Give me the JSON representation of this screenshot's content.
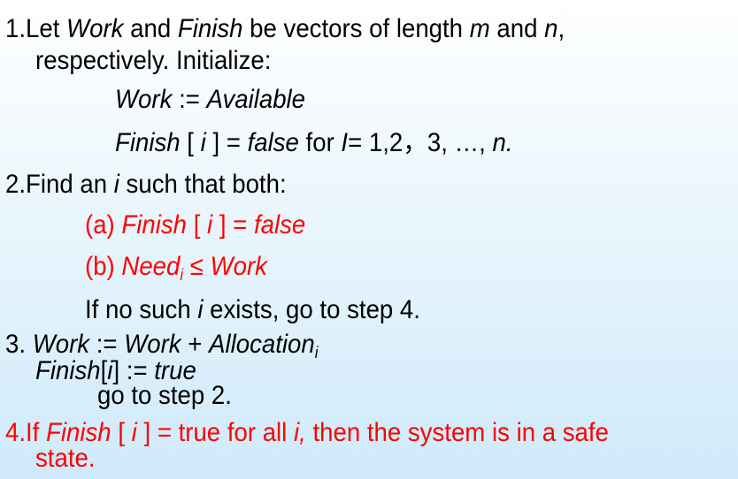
{
  "step1": {
    "line1": {
      "p1": "1.Let ",
      "i1": "Work",
      "p2": " and ",
      "i2": "Finish",
      "p3": " be vectors of length ",
      "i3": "m",
      "p4": " and ",
      "i4": "n",
      "p5": ","
    },
    "line2": "respectively.  Initialize:",
    "work_init": {
      "i1": "Work",
      "p1": " := ",
      "i2": "Available"
    },
    "finish_init": {
      "i1": "Finish",
      "p1": " [ ",
      "i2": "i",
      "p2": " ] = ",
      "i3": "false",
      "p3": " for ",
      "i4": "I",
      "p4": "= 1,2，3, …, ",
      "i5": "n."
    }
  },
  "step2": {
    "title": {
      "p1": "2.Find an ",
      "i1": "i",
      "p2": " such that both:"
    },
    "cond_a": {
      "p1": "(a) ",
      "i1": "Finish",
      "p2": " [ ",
      "i2": "i",
      "p3": " ] = ",
      "i3": "false"
    },
    "cond_b": {
      "p1": "(b) ",
      "i1": "Need",
      "sub": "i",
      "p2": " ≤ ",
      "i2": "Work"
    },
    "fallback": {
      "p1": "If no such ",
      "i1": "i",
      "p2": " exists, go to step 4."
    }
  },
  "step3": {
    "line1": {
      "p1": "3. ",
      "i1": "Work",
      "p2": " := ",
      "i2": "Work",
      "p3": " + ",
      "i3": "Allocation",
      "sub": "i"
    },
    "line2": {
      "i1": "Finish",
      "p1": "[",
      "i2": "i",
      "p2": "] := ",
      "i3": "true"
    },
    "line3": "go to step 2."
  },
  "step4": {
    "line1": {
      "p1": "4.If ",
      "i1": "Finish",
      "p2": " [ ",
      "i2": "i",
      "p3": " ] = true for all ",
      "i3": "i,",
      "p4": " then the system is in a safe"
    },
    "line2": "state."
  },
  "colors": {
    "emphasis": "#ff0000",
    "text": "#000000"
  }
}
